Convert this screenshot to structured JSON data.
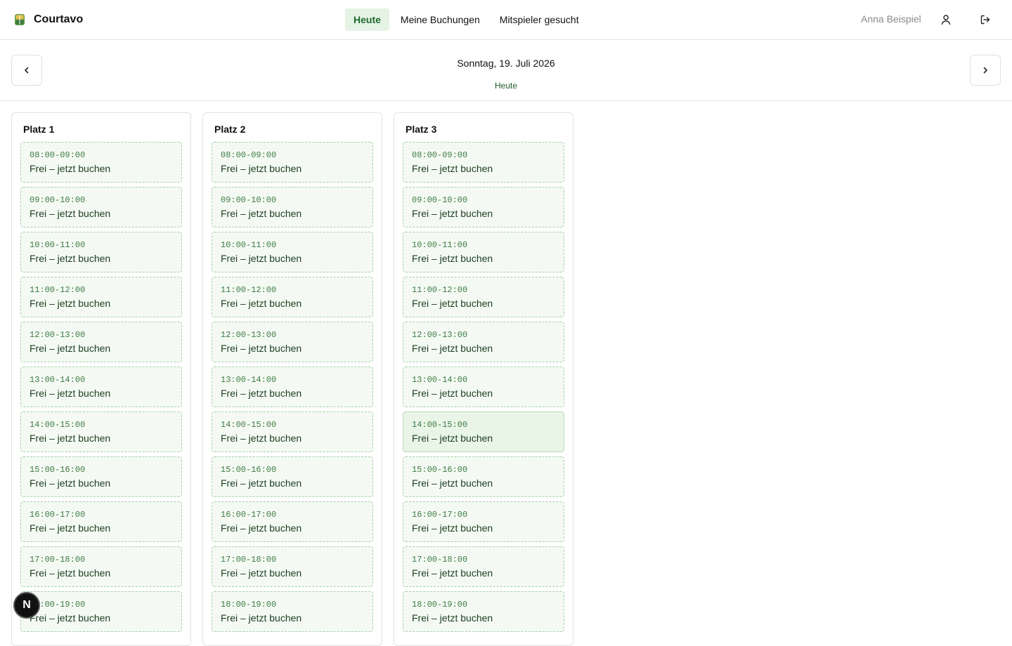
{
  "header": {
    "brand": "Courtavo",
    "nav": [
      "Heute",
      "Meine Buchungen",
      "Mitspieler gesucht"
    ],
    "active_nav": "Heute",
    "user_name": "Anna Beispiel",
    "icons": {
      "brand": "court-logo-icon",
      "profile": "user-icon",
      "logout": "logout-icon"
    }
  },
  "datebar": {
    "date": "Sonntag, 19. Juli 2026",
    "relative": "Heute",
    "prev_icon": "chevron-left-icon",
    "next_icon": "chevron-right-icon"
  },
  "slot_label": "Frei – jetzt buchen",
  "courts": [
    {
      "name": "Platz 1",
      "slots": [
        "08:00-09:00",
        "09:00-10:00",
        "10:00-11:00",
        "11:00-12:00",
        "12:00-13:00",
        "13:00-14:00",
        "14:00-15:00",
        "15:00-16:00",
        "16:00-17:00",
        "17:00-18:00",
        "18:00-19:00"
      ]
    },
    {
      "name": "Platz 2",
      "slots": [
        "08:00-09:00",
        "09:00-10:00",
        "10:00-11:00",
        "11:00-12:00",
        "12:00-13:00",
        "13:00-14:00",
        "14:00-15:00",
        "15:00-16:00",
        "16:00-17:00",
        "17:00-18:00",
        "18:00-19:00"
      ]
    },
    {
      "name": "Platz 3",
      "slots": [
        "08:00-09:00",
        "09:00-10:00",
        "10:00-11:00",
        "11:00-12:00",
        "12:00-13:00",
        "13:00-14:00",
        "14:00-15:00",
        "15:00-16:00",
        "16:00-17:00",
        "17:00-18:00",
        "18:00-19:00"
      ],
      "hovered_slot": "14:00-15:00"
    }
  ],
  "fab": {
    "label": "N"
  },
  "colors": {
    "accent": "#1f6b2e",
    "nav_active_bg": "#e5f3e4",
    "slot_bg": "#f4faf3",
    "slot_border": "#a8cfa7"
  }
}
